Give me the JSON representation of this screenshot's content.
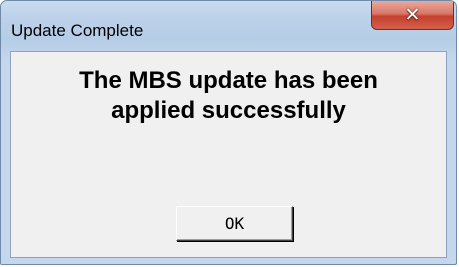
{
  "window": {
    "title": "Update Complete",
    "close_glyph": "✕"
  },
  "dialog": {
    "message_lines": [
      "The MBS update has been",
      "applied successfully"
    ],
    "ok_label": "OK"
  },
  "colors": {
    "close_button": "#c4402f",
    "frame": "#bcd1e9",
    "client": "#f0f0f0"
  }
}
